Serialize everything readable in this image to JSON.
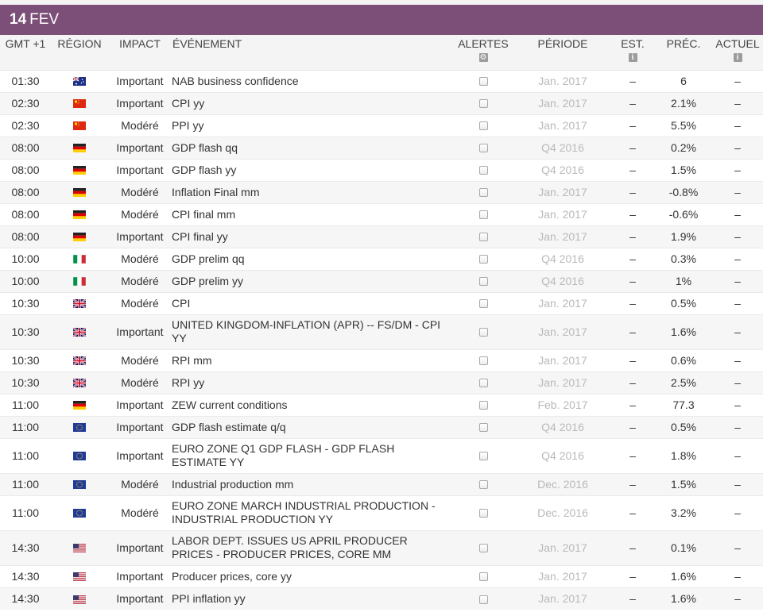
{
  "day": {
    "number": "14",
    "month": "FEV"
  },
  "headers": {
    "time": "GMT +1",
    "region": "RÉGION",
    "impact": "IMPACT",
    "event": "ÉVÉNEMENT",
    "alerts": "ALERTES",
    "period": "PÉRIODE",
    "est": "EST.",
    "prev": "PRÉC.",
    "actual": "ACTUEL"
  },
  "colors": {
    "header_bar": "#7c4f79",
    "muted_period": "#b9b9b9"
  },
  "rows": [
    {
      "time": "01:30",
      "flag": "au-flag-icon",
      "impact": "Important",
      "event": "NAB business confidence",
      "period": "Jan. 2017",
      "est": "–",
      "prev": "6",
      "actual": "–"
    },
    {
      "time": "02:30",
      "flag": "cn-flag-icon",
      "impact": "Important",
      "event": "CPI yy",
      "period": "Jan. 2017",
      "est": "–",
      "prev": "2.1%",
      "actual": "–"
    },
    {
      "time": "02:30",
      "flag": "cn-flag-icon",
      "impact": "Modéré",
      "event": "PPI yy",
      "period": "Jan. 2017",
      "est": "–",
      "prev": "5.5%",
      "actual": "–"
    },
    {
      "time": "08:00",
      "flag": "de-flag-icon",
      "impact": "Important",
      "event": "GDP flash qq",
      "period": "Q4 2016",
      "est": "–",
      "prev": "0.2%",
      "actual": "–"
    },
    {
      "time": "08:00",
      "flag": "de-flag-icon",
      "impact": "Important",
      "event": "GDP flash yy",
      "period": "Q4 2016",
      "est": "–",
      "prev": "1.5%",
      "actual": "–"
    },
    {
      "time": "08:00",
      "flag": "de-flag-icon",
      "impact": "Modéré",
      "event": "Inflation Final mm",
      "period": "Jan. 2017",
      "est": "–",
      "prev": "-0.8%",
      "actual": "–"
    },
    {
      "time": "08:00",
      "flag": "de-flag-icon",
      "impact": "Modéré",
      "event": "CPI final mm",
      "period": "Jan. 2017",
      "est": "–",
      "prev": "-0.6%",
      "actual": "–"
    },
    {
      "time": "08:00",
      "flag": "de-flag-icon",
      "impact": "Important",
      "event": "CPI final yy",
      "period": "Jan. 2017",
      "est": "–",
      "prev": "1.9%",
      "actual": "–"
    },
    {
      "time": "10:00",
      "flag": "it-flag-icon",
      "impact": "Modéré",
      "event": "GDP prelim qq",
      "period": "Q4 2016",
      "est": "–",
      "prev": "0.3%",
      "actual": "–"
    },
    {
      "time": "10:00",
      "flag": "it-flag-icon",
      "impact": "Modéré",
      "event": "GDP prelim yy",
      "period": "Q4 2016",
      "est": "–",
      "prev": "1%",
      "actual": "–"
    },
    {
      "time": "10:30",
      "flag": "gb-flag-icon",
      "impact": "Modéré",
      "event": "CPI",
      "period": "Jan. 2017",
      "est": "–",
      "prev": "0.5%",
      "actual": "–"
    },
    {
      "time": "10:30",
      "flag": "gb-flag-icon",
      "impact": "Important",
      "event": "UNITED KINGDOM-INFLATION (APR) -- FS/DM - CPI YY",
      "period": "Jan. 2017",
      "est": "–",
      "prev": "1.6%",
      "actual": "–"
    },
    {
      "time": "10:30",
      "flag": "gb-flag-icon",
      "impact": "Modéré",
      "event": "RPI mm",
      "period": "Jan. 2017",
      "est": "–",
      "prev": "0.6%",
      "actual": "–"
    },
    {
      "time": "10:30",
      "flag": "gb-flag-icon",
      "impact": "Modéré",
      "event": "RPI yy",
      "period": "Jan. 2017",
      "est": "–",
      "prev": "2.5%",
      "actual": "–"
    },
    {
      "time": "11:00",
      "flag": "de-flag-icon",
      "impact": "Important",
      "event": "ZEW current conditions",
      "period": "Feb. 2017",
      "est": "–",
      "prev": "77.3",
      "actual": "–"
    },
    {
      "time": "11:00",
      "flag": "eu-flag-icon",
      "impact": "Important",
      "event": "GDP flash estimate q/q",
      "period": "Q4 2016",
      "est": "–",
      "prev": "0.5%",
      "actual": "–"
    },
    {
      "time": "11:00",
      "flag": "eu-flag-icon",
      "impact": "Important",
      "event": "EURO ZONE Q1 GDP FLASH - GDP FLASH ESTIMATE YY",
      "period": "Q4 2016",
      "est": "–",
      "prev": "1.8%",
      "actual": "–"
    },
    {
      "time": "11:00",
      "flag": "eu-flag-icon",
      "impact": "Modéré",
      "event": "Industrial production mm",
      "period": "Dec. 2016",
      "est": "–",
      "prev": "1.5%",
      "actual": "–"
    },
    {
      "time": "11:00",
      "flag": "eu-flag-icon",
      "impact": "Modéré",
      "event": "EURO ZONE MARCH INDUSTRIAL PRODUCTION - INDUSTRIAL PRODUCTION YY",
      "period": "Dec. 2016",
      "est": "–",
      "prev": "3.2%",
      "actual": "–"
    },
    {
      "time": "14:30",
      "flag": "us-flag-icon",
      "impact": "Important",
      "event": "LABOR DEPT. ISSUES US APRIL PRODUCER PRICES - PRODUCER PRICES, CORE MM",
      "period": "Jan. 2017",
      "est": "–",
      "prev": "0.1%",
      "actual": "–"
    },
    {
      "time": "14:30",
      "flag": "us-flag-icon",
      "impact": "Important",
      "event": "Producer prices, core yy",
      "period": "Jan. 2017",
      "est": "–",
      "prev": "1.6%",
      "actual": "–"
    },
    {
      "time": "14:30",
      "flag": "us-flag-icon",
      "impact": "Important",
      "event": "PPI inflation yy",
      "period": "Jan. 2017",
      "est": "–",
      "prev": "1.6%",
      "actual": "–"
    }
  ]
}
